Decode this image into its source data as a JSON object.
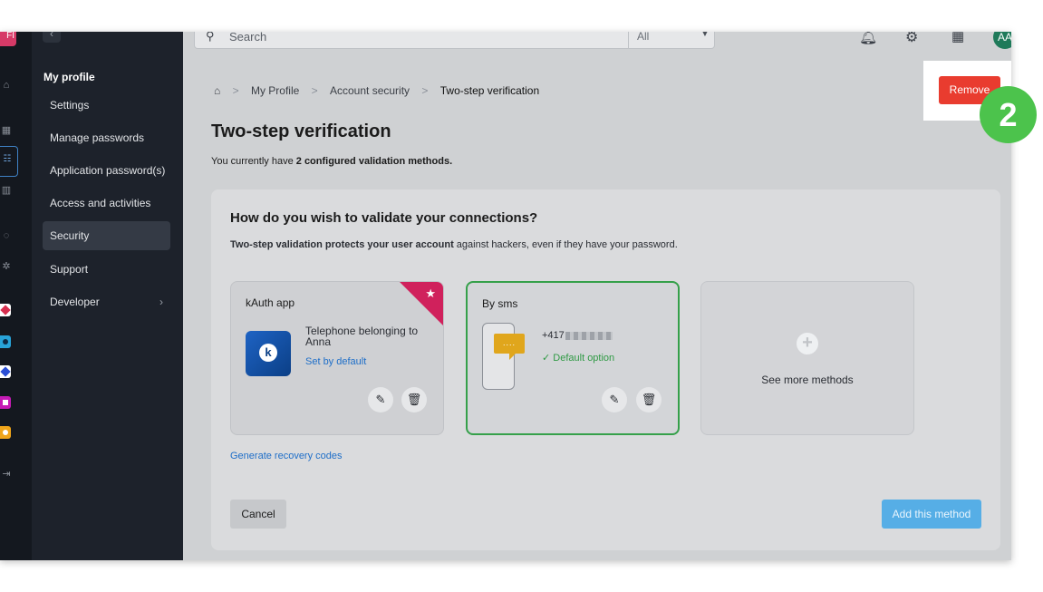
{
  "topbar": {
    "search_placeholder": "Search",
    "search_scope": "All",
    "avatar_initials": "AA"
  },
  "rail": {
    "logo_text": "FI"
  },
  "sidebar": {
    "group_label": "My profile",
    "items": [
      {
        "label": "Settings"
      },
      {
        "label": "Manage passwords"
      },
      {
        "label": "Application password(s)"
      },
      {
        "label": "Access and activities"
      },
      {
        "label": "Security",
        "active": true
      },
      {
        "label": "Support"
      },
      {
        "label": "Developer"
      }
    ]
  },
  "breadcrumb": {
    "items": [
      "My Profile",
      "Account security",
      "Two-step verification"
    ],
    "separator": ">"
  },
  "page": {
    "title": "Two-step verification",
    "subtitle_prefix": "You currently have ",
    "subtitle_bold": "2 configured validation methods."
  },
  "panel": {
    "heading": "How do you wish to validate your connections?",
    "description_bold": "Two-step validation protects your user account",
    "description_rest": " against hackers, even if they have your password.",
    "cards": {
      "kauth": {
        "title": "kAuth app",
        "logo_letter": "k",
        "device": "Telephone belonging to Anna",
        "set_default": "Set by default"
      },
      "sms": {
        "title": "By sms",
        "bubble": "....",
        "number_prefix": "+417",
        "default_option": "Default option"
      },
      "more": {
        "plus": "+",
        "label": "See more methods"
      }
    },
    "recovery_link": "Generate recovery codes",
    "cancel_label": "Cancel",
    "add_label": "Add this method"
  },
  "actions": {
    "remove_label": "Remove"
  },
  "annotation": {
    "step_number": "2"
  },
  "colors": {
    "accent_blue": "#56aee6",
    "link_blue": "#1e6ec8",
    "danger_red": "#e93c2f",
    "success_green": "#35a04a",
    "step_green": "#4cc34c",
    "ribbon_pink": "#d0215c"
  }
}
